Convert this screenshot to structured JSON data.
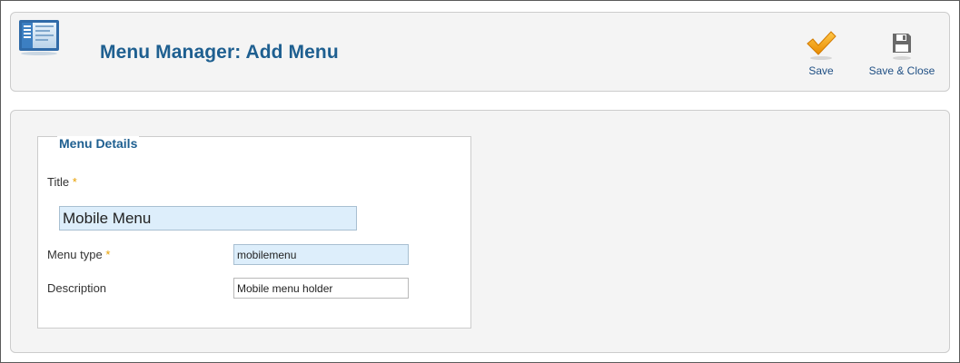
{
  "header": {
    "title": "Menu Manager: Add Menu",
    "icon": "menu-manager-icon"
  },
  "toolbar": {
    "save_label": "Save",
    "save_close_label": "Save & Close",
    "save_icon": "checkmark-icon",
    "save_close_icon": "floppy-disk-icon",
    "accent_color": "#f0a000"
  },
  "form": {
    "legend": "Menu Details",
    "title_label": "Title",
    "title_required": "*",
    "title_value": "Mobile Menu",
    "menu_type_label": "Menu type",
    "menu_type_required": "*",
    "menu_type_value": "mobilemenu",
    "description_label": "Description",
    "description_value": "Mobile menu holder"
  }
}
